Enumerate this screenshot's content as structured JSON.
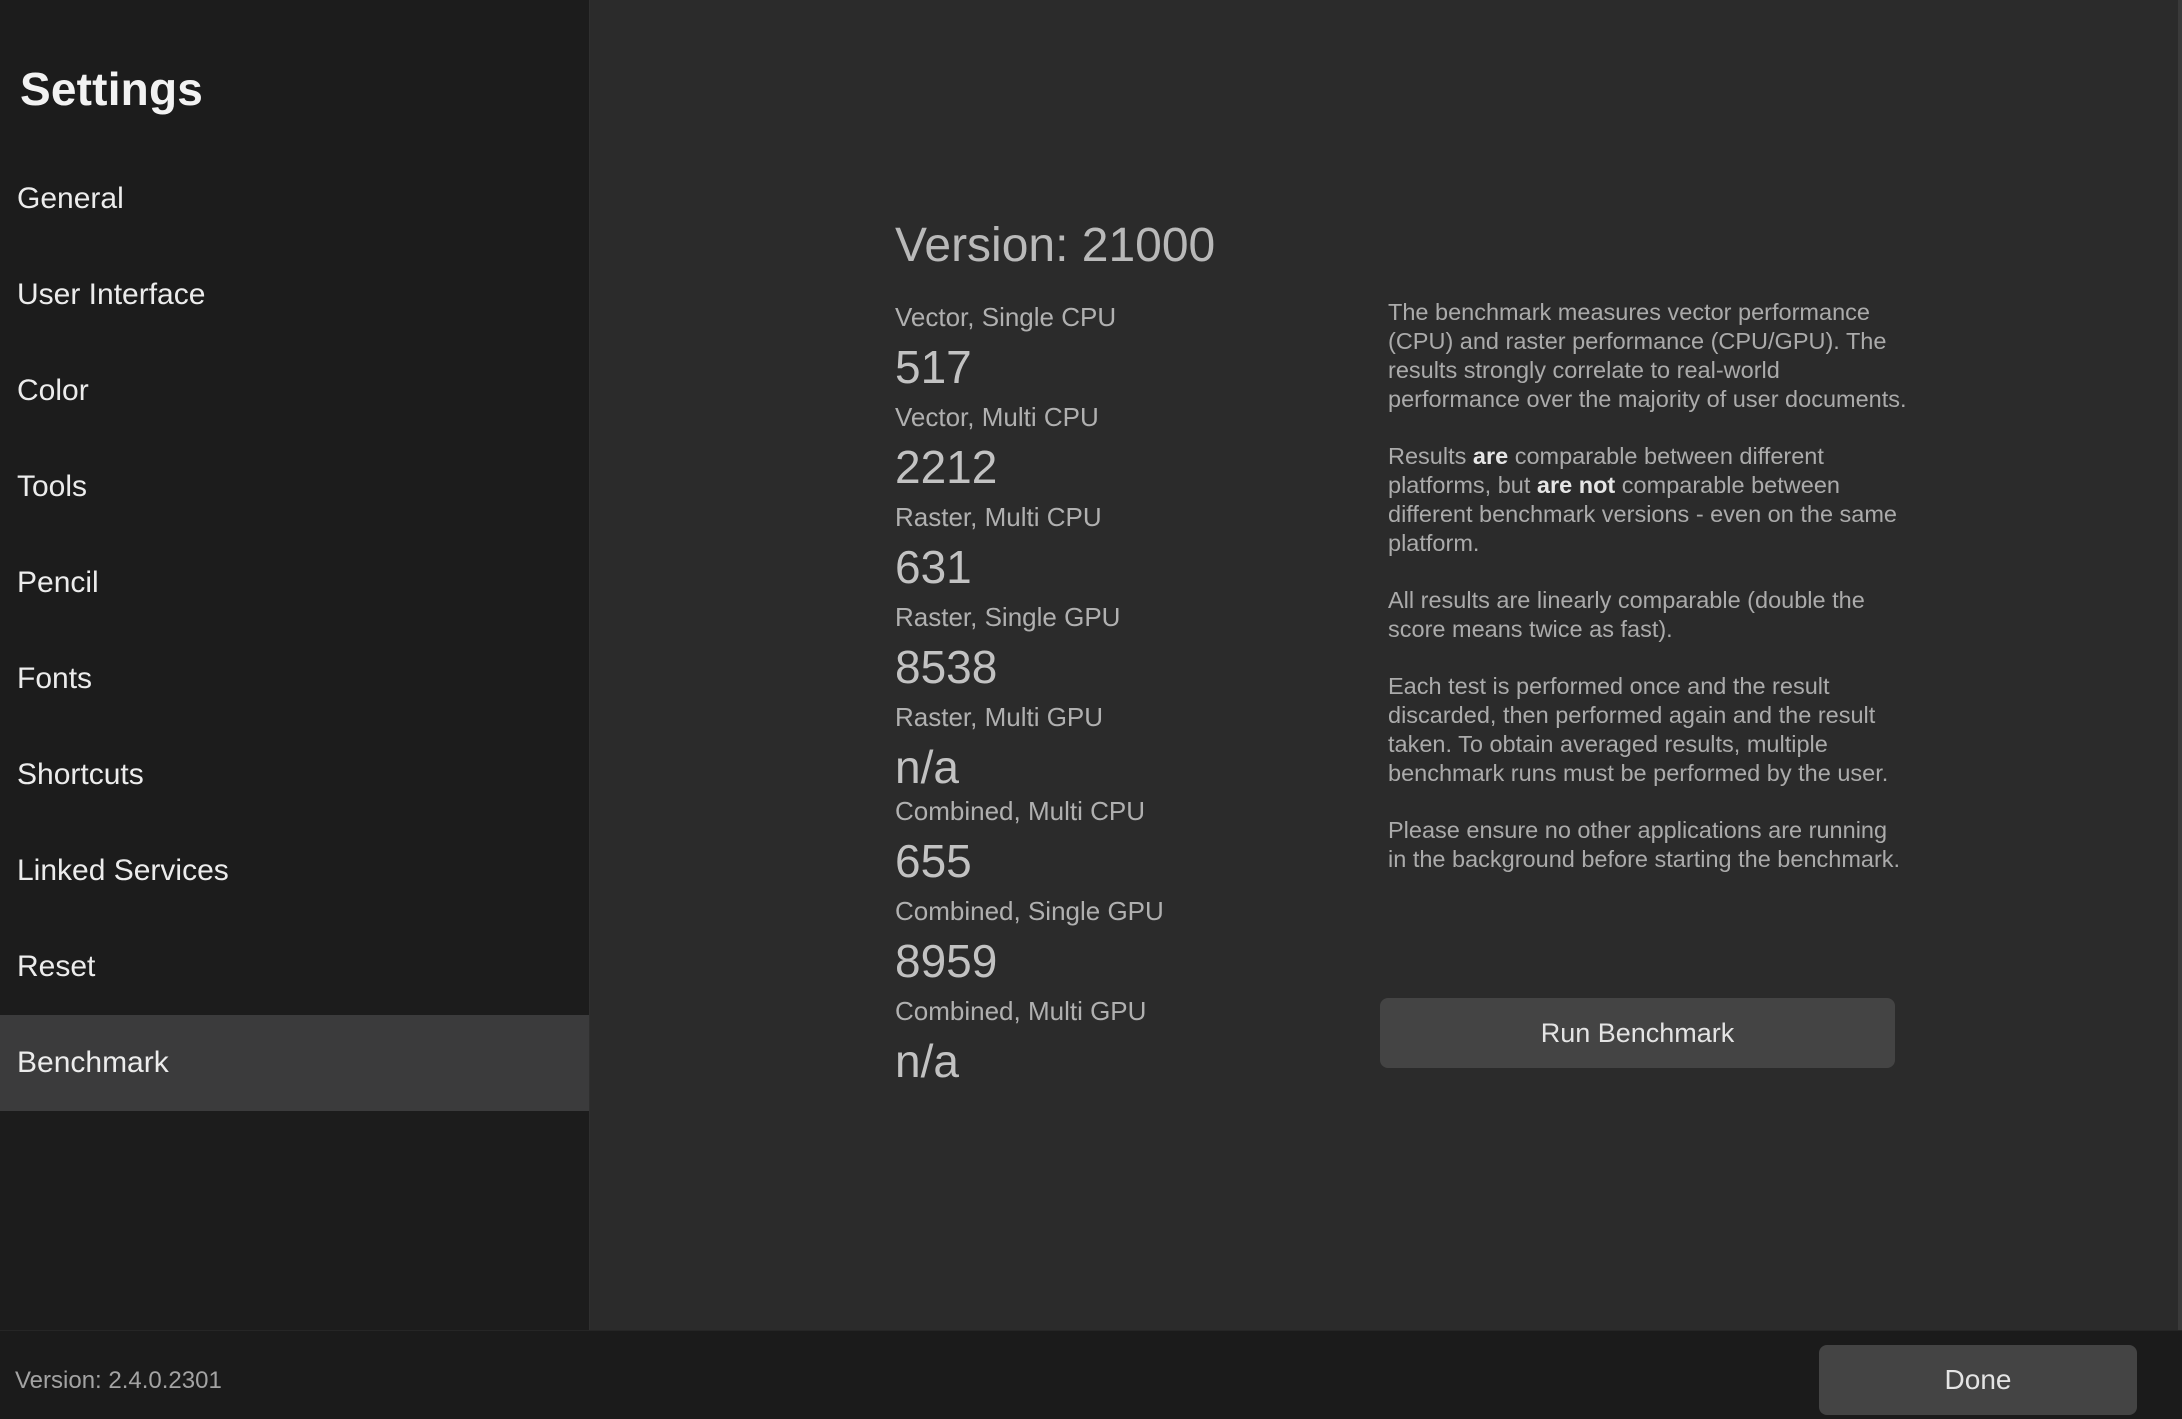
{
  "sidebar": {
    "title": "Settings",
    "items": [
      {
        "label": "General"
      },
      {
        "label": "User Interface"
      },
      {
        "label": "Color"
      },
      {
        "label": "Tools"
      },
      {
        "label": "Pencil"
      },
      {
        "label": "Fonts"
      },
      {
        "label": "Shortcuts"
      },
      {
        "label": "Linked Services"
      },
      {
        "label": "Reset"
      },
      {
        "label": "Benchmark"
      }
    ],
    "selected": "Benchmark"
  },
  "main": {
    "version_heading": "Version: 21000",
    "results": [
      {
        "label": "Vector, Single CPU",
        "value": "517"
      },
      {
        "label": "Vector, Multi CPU",
        "value": "2212"
      },
      {
        "label": "Raster, Multi CPU",
        "value": "631"
      },
      {
        "label": "Raster, Single GPU",
        "value": "8538"
      },
      {
        "label": "Raster, Multi GPU",
        "value": "n/a"
      },
      {
        "label": "Combined, Multi CPU",
        "value": "655"
      },
      {
        "label": "Combined, Single GPU",
        "value": "8959"
      },
      {
        "label": "Combined, Multi GPU",
        "value": "n/a"
      }
    ],
    "description": {
      "p1": "The benchmark measures vector performance (CPU) and raster performance (CPU/GPU). The results strongly correlate to real-world performance over the majority of user documents.",
      "p2_a": "Results ",
      "p2_b": "are",
      "p2_c": " comparable between different platforms, but ",
      "p2_d": "are not",
      "p2_e": " comparable between different benchmark versions - even on the same platform.",
      "p3": "All results are linearly comparable (double the score means twice as fast).",
      "p4": "Each test is performed once and the result discarded, then performed again and the result taken. To obtain averaged results, multiple benchmark runs must be performed by the user.",
      "p5": "Please ensure no other applications are running in the background before starting the benchmark."
    },
    "run_button_label": "Run Benchmark"
  },
  "footer": {
    "version": "Version: 2.4.0.2301",
    "done_label": "Done"
  }
}
